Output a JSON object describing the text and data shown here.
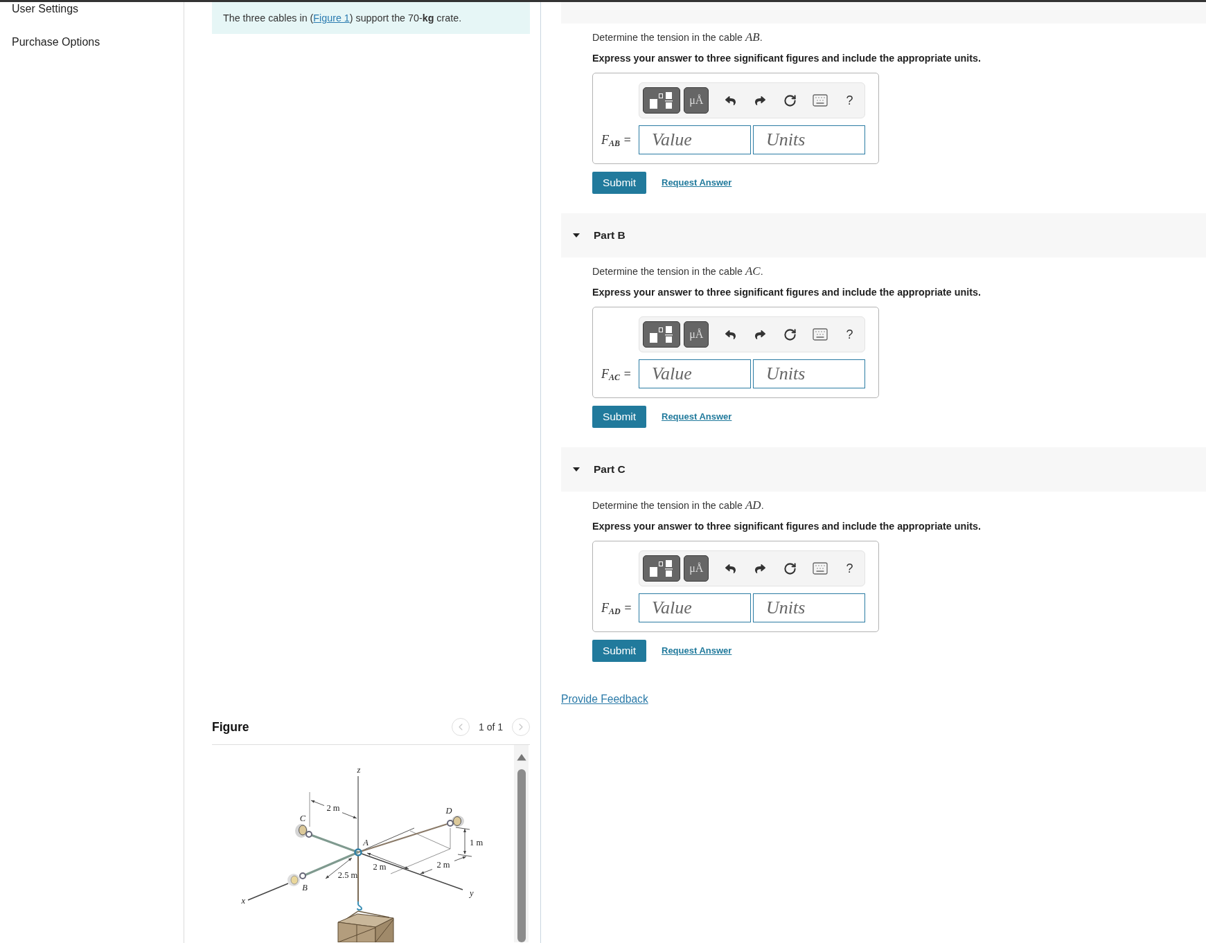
{
  "sidebar": {
    "items": [
      {
        "label": "User Settings"
      },
      {
        "label": "Purchase Options"
      }
    ]
  },
  "problem": {
    "text_before": "The three cables in (",
    "link": "Figure 1",
    "text_after": ") support the 70-**kg** crate."
  },
  "figure": {
    "title": "Figure",
    "pager": {
      "label": "1 of 1",
      "prev_disabled": true,
      "next_disabled": true
    },
    "labels": [
      {
        "text": "z",
        "kind": "axis"
      },
      {
        "text": "2 m",
        "kind": "dimension"
      },
      {
        "text": "C",
        "kind": "point"
      },
      {
        "text": "D",
        "kind": "point"
      },
      {
        "text": "A",
        "kind": "point"
      },
      {
        "text": "1 m",
        "kind": "dimension"
      },
      {
        "text": "2 m",
        "kind": "dimension"
      },
      {
        "text": "2.5 m",
        "kind": "dimension"
      },
      {
        "text": "2 m",
        "kind": "dimension"
      },
      {
        "text": "B",
        "kind": "point"
      },
      {
        "text": "y",
        "kind": "axis"
      },
      {
        "text": "x",
        "kind": "axis"
      }
    ]
  },
  "parts": [
    {
      "prompt": "Determine the tension in the cable *AB*.",
      "instruction": "Express your answer to three significant figures and include the appropriate units.",
      "answer": {
        "label": "F$_{AB}$ =",
        "symbols_label": "μÅ",
        "help_label": "?",
        "value": {
          "placeholder": "Value"
        },
        "units": {
          "placeholder": "Units"
        }
      },
      "submit": "Submit",
      "request_answer": "Request Answer"
    },
    {
      "title": "Part B",
      "expanded": true,
      "prompt": "Determine the tension in the cable *AC*.",
      "instruction": "Express your answer to three significant figures and include the appropriate units.",
      "answer": {
        "label": "F$_{AC}$ =",
        "symbols_label": "μÅ",
        "help_label": "?",
        "value": {
          "placeholder": "Value"
        },
        "units": {
          "placeholder": "Units"
        }
      },
      "submit": "Submit",
      "request_answer": "Request Answer"
    },
    {
      "title": "Part C",
      "expanded": true,
      "prompt": "Determine the tension in the cable *AD*.",
      "instruction": "Express your answer to three significant figures and include the appropriate units.",
      "answer": {
        "label": "F$_{AD}$ =",
        "symbols_label": "μÅ",
        "help_label": "?",
        "value": {
          "placeholder": "Value"
        },
        "units": {
          "placeholder": "Units"
        }
      },
      "submit": "Submit",
      "request_answer": "Request Answer"
    }
  ],
  "feedback_link": "Provide Feedback"
}
